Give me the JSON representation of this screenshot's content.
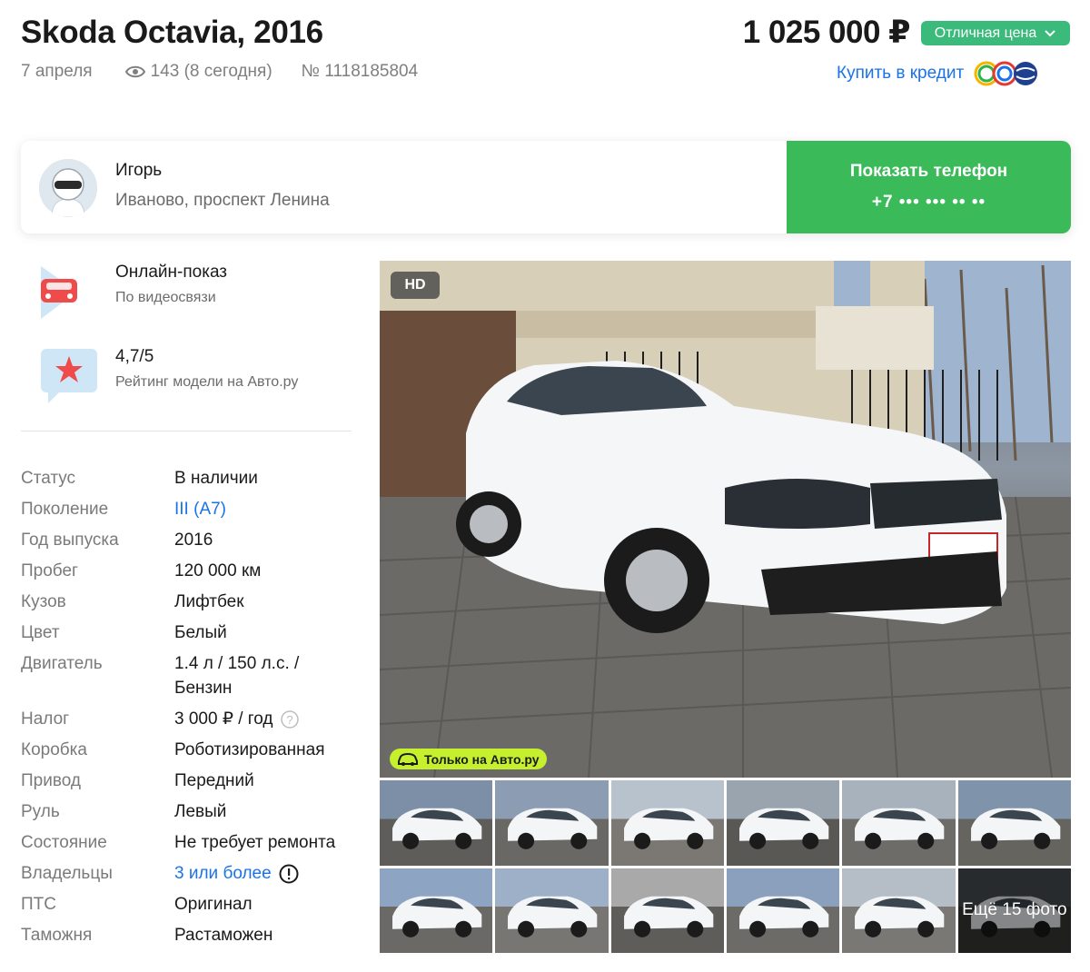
{
  "listing": {
    "title": "Skoda Octavia, 2016",
    "date": "7 апреля",
    "views": "143 (8 сегодня)",
    "number": "№ 1118185804",
    "price": "1 025 000 ₽",
    "price_badge": "Отличная цена",
    "credit_link": "Купить в кредит"
  },
  "seller": {
    "name": "Игорь",
    "location": "Иваново, проспект Ленина",
    "phone_button": "Показать телефон",
    "phone_masked": "+7 ••• ••• •• ••"
  },
  "features": [
    {
      "title": "Онлайн-показ",
      "subtitle": "По видеосвязи",
      "icon": "car-video-icon"
    },
    {
      "title": "4,7/5",
      "subtitle": "Рейтинг модели на Авто.ру",
      "icon": "star-rating-icon"
    }
  ],
  "specs": [
    {
      "key": "Статус",
      "value": "В наличии"
    },
    {
      "key": "Поколение",
      "value": "III (A7)",
      "link": true
    },
    {
      "key": "Год выпуска",
      "value": "2016"
    },
    {
      "key": "Пробег",
      "value": "120 000 км"
    },
    {
      "key": "Кузов",
      "value": "Лифтбек"
    },
    {
      "key": "Цвет",
      "value": "Белый"
    },
    {
      "key": "Двигатель",
      "value": "1.4 л / 150 л.с. / Бензин"
    },
    {
      "key": "Налог",
      "value": "3 000 ₽ / год"
    },
    {
      "key": "Коробка",
      "value": "Роботизированная"
    },
    {
      "key": "Привод",
      "value": "Передний"
    },
    {
      "key": "Руль",
      "value": "Левый"
    },
    {
      "key": "Состояние",
      "value": "Не требует ремонта"
    },
    {
      "key": "Владельцы",
      "value": "3 или более",
      "link": true
    },
    {
      "key": "ПТС",
      "value": "Оригинал"
    },
    {
      "key": "Таможня",
      "value": "Растаможен"
    }
  ],
  "gallery": {
    "hd_badge": "HD",
    "only_badge": "Только на Авто.ру",
    "more_photos": "Ещё 15 фото",
    "thumb_count": 12
  }
}
